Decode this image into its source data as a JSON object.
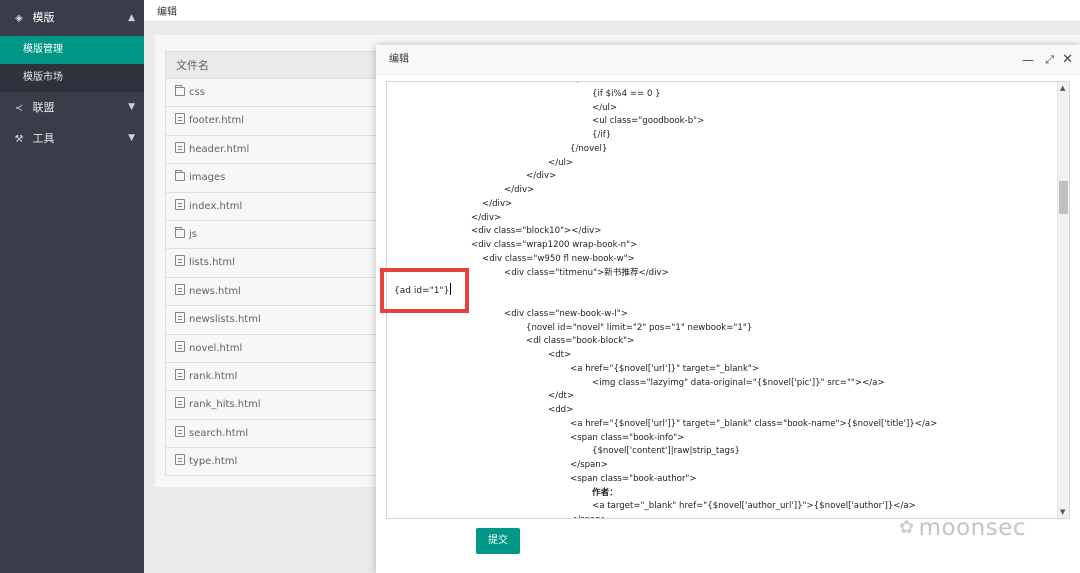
{
  "sidebar": {
    "group_templates": {
      "label": "模版",
      "icon": "layers-icon"
    },
    "items": [
      {
        "label": "模版管理",
        "active": true
      },
      {
        "label": "模版市场",
        "active": false
      }
    ],
    "group_alliance": {
      "label": "联盟",
      "icon": "share-icon"
    },
    "group_tools": {
      "label": "工具",
      "icon": "tools-icon"
    }
  },
  "header": {
    "title": "编辑"
  },
  "file_table": {
    "column_header": "文件名",
    "rows": [
      {
        "name": "css",
        "type": "folder"
      },
      {
        "name": "footer.html",
        "type": "file"
      },
      {
        "name": "header.html",
        "type": "file"
      },
      {
        "name": "images",
        "type": "folder"
      },
      {
        "name": "index.html",
        "type": "file"
      },
      {
        "name": "js",
        "type": "folder"
      },
      {
        "name": "lists.html",
        "type": "file"
      },
      {
        "name": "news.html",
        "type": "file"
      },
      {
        "name": "newslists.html",
        "type": "file"
      },
      {
        "name": "novel.html",
        "type": "file"
      },
      {
        "name": "rank.html",
        "type": "file"
      },
      {
        "name": "rank_hits.html",
        "type": "file"
      },
      {
        "name": "search.html",
        "type": "file"
      },
      {
        "name": "type.html",
        "type": "file"
      }
    ]
  },
  "modal": {
    "title": "编辑",
    "controls": {
      "minimize": "—",
      "maximize": "⤢",
      "close": "✕"
    },
    "code_lines": [
      "</ul>",
      "{if $i%4 == 0 }",
      "</ul>",
      "<ul class=\"goodbook-b\">",
      "{/if}",
      "{/novel}",
      "</ul>",
      "</div>",
      "</div>",
      "</div>",
      "</div>",
      "<div class=\"block10\"></div>",
      "<div class=\"wrap1200 wrap-book-n\">",
      "<div class=\"w950 fl new-book-w\">",
      "<div class=\"titmenu\">新书推荐</div>",
      "",
      "",
      "<div class=\"new-book-w-l\">",
      "{novel id=\"novel\" limit=\"2\" pos=\"1\" newbook=\"1\"}",
      "<dl class=\"book-block\">",
      "<dt>",
      "<a href=\"{$novel['url']}\" target=\"_blank\">",
      "<img class=\"lazyimg\" data-original=\"{$novel['pic']}\" src=\"\"></a>",
      "</dt>",
      "<dd>",
      "<a href=\"{$novel['url']}\" target=\"_blank\" class=\"book-name\">{$novel['title']}</a>",
      "<span class=\"book-info\">",
      "{$novel['content']|raw|strip_tags}",
      "</span>",
      "<span class=\"book-author\">",
      "作者：",
      "<a target=\"_blank\" href=\"{$novel['author_url']}\">{$novel['author']}</a>",
      "</span>"
    ],
    "inserted_tag": "{ad id=\"1\"}",
    "submit_label": "提交"
  },
  "watermark": {
    "text": "moonsec",
    "icon": "wechat-icon"
  },
  "colors": {
    "sidebar": "#393d49",
    "accent": "#009688",
    "highlight": "#e8413c"
  }
}
